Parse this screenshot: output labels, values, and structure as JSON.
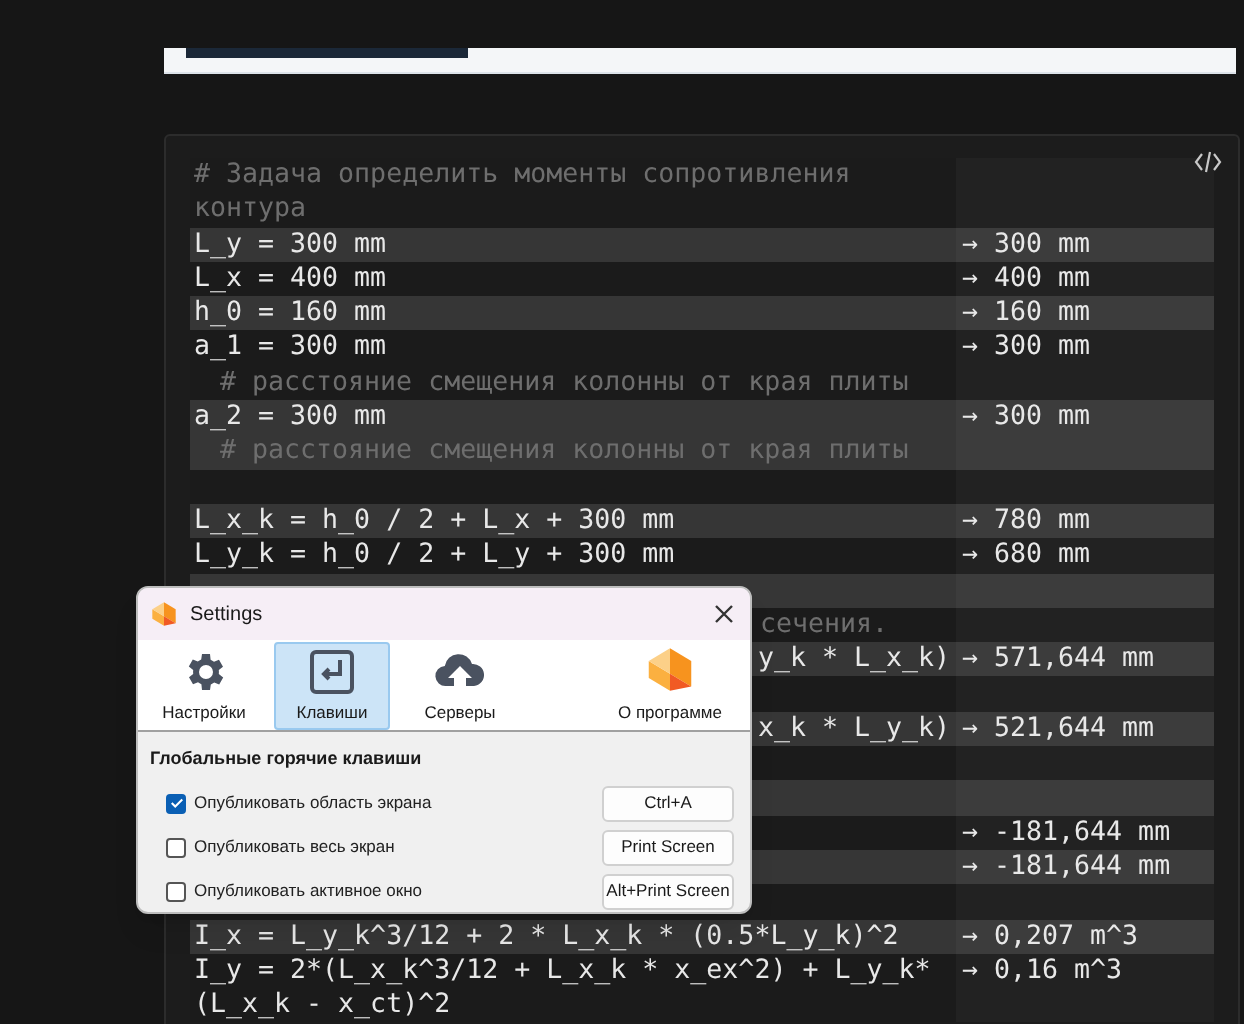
{
  "notebook": {
    "lines": [
      {
        "kind": "comment",
        "text": "# Задача определить моменты сопротивления контура",
        "highlighted": false
      },
      {
        "kind": "code",
        "text": "L_y = 300 mm",
        "result": "→ 300 mm",
        "highlighted": true
      },
      {
        "kind": "code",
        "text": "L_x = 400 mm",
        "result": "→ 400 mm",
        "highlighted": false
      },
      {
        "kind": "code",
        "text": "h_0 = 160 mm",
        "result": "→ 160 mm",
        "highlighted": true
      },
      {
        "kind": "code",
        "text": "a_1 = 300 mm",
        "result": "→ 300 mm",
        "highlighted": false
      },
      {
        "kind": "note",
        "text": "# расстояние смещения колонны от края плиты",
        "highlighted": false
      },
      {
        "kind": "code",
        "text": "a_2 = 300 mm",
        "result": "→ 300 mm",
        "highlighted": true
      },
      {
        "kind": "note",
        "text": "# расстояние смещения колонны от края плиты",
        "highlighted": true
      },
      {
        "kind": "blank",
        "highlighted": false
      },
      {
        "kind": "code",
        "text": "L_x_k = h_0 / 2 + L_x + 300 mm",
        "result": "→ 780 mm",
        "highlighted": true
      },
      {
        "kind": "code",
        "text": "L_y_k = h_0 / 2 + L_y + 300 mm",
        "result": "→ 680 mm",
        "highlighted": false
      },
      {
        "kind": "blank",
        "highlighted": true
      },
      {
        "kind": "cut_comment",
        "text": "сечения.",
        "highlighted": false
      },
      {
        "kind": "cut_code",
        "text": "y_k * L_x_k)",
        "result": "→ 571,644 mm",
        "highlighted": true
      },
      {
        "kind": "blank",
        "highlighted": false
      },
      {
        "kind": "cut_code",
        "text": "x_k * L_y_k)",
        "result": "→ 521,644 mm",
        "highlighted": true
      },
      {
        "kind": "blank",
        "highlighted": false
      },
      {
        "kind": "blank",
        "highlighted": true
      },
      {
        "kind": "blank",
        "result": "→ -181,644 mm",
        "highlighted": false
      },
      {
        "kind": "blank",
        "result": "→ -181,644 mm",
        "highlighted": true
      },
      {
        "kind": "blank",
        "highlighted": false
      },
      {
        "kind": "code",
        "text": "I_x = L_y_k^3/12 + 2 * L_x_k * (0.5*L_y_k)^2",
        "result": "→ 0,207 m^3",
        "highlighted": true
      },
      {
        "kind": "code",
        "text": "I_y = 2*(L_x_k^3/12 + L_x_k * x_ex^2) + L_y_k*(L_x_k - x_ct)^2",
        "result": "→ 0,16 m^3",
        "highlighted": false
      }
    ]
  },
  "dialog": {
    "title": "Settings",
    "tabs": [
      {
        "label": "Настройки",
        "kind": "gear",
        "selected": false
      },
      {
        "label": "Клавиши",
        "kind": "enter",
        "selected": true
      },
      {
        "label": "Серверы",
        "kind": "cloud",
        "selected": false
      },
      {
        "label": "О программе",
        "kind": "logo",
        "selected": false
      }
    ],
    "section_title": "Глобальные горячие клавиши",
    "hotkeys": [
      {
        "label": "Опубликовать область экрана",
        "checked": true,
        "shortcut": "Ctrl+A"
      },
      {
        "label": "Опубликовать весь экран",
        "checked": false,
        "shortcut": "Print Screen"
      },
      {
        "label": "Опубликовать активное окно",
        "checked": false,
        "shortcut": "Alt+Print Screen"
      }
    ]
  }
}
